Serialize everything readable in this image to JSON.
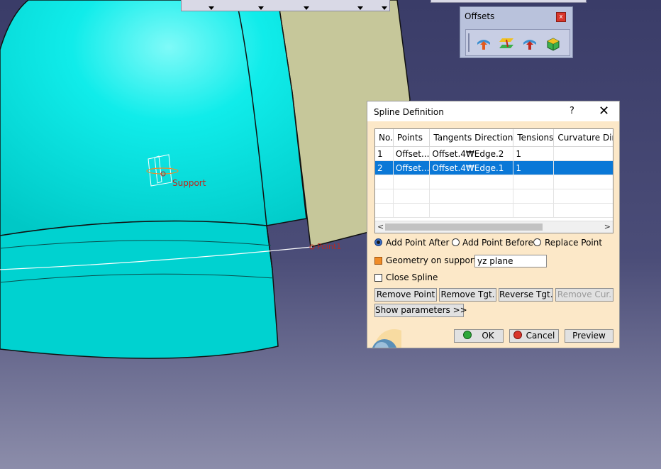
{
  "offsets_toolbar": {
    "title": "Offsets",
    "close": "x"
  },
  "dialog": {
    "title": "Spline Definition",
    "help": "?",
    "close": "✕",
    "table": {
      "headers": [
        "No.",
        "Points",
        "Tangents Direction",
        "Tensions",
        "Curvature Direc"
      ],
      "rows": [
        [
          "1",
          "Offset...",
          "Offset.4₩Edge.2",
          "1",
          ""
        ],
        [
          "2",
          "Offset...",
          "Offset.4₩Edge.1",
          "1",
          ""
        ]
      ],
      "selected_row": 2
    },
    "options": {
      "add_point_after": "Add Point After",
      "add_point_before": "Add Point Before",
      "replace_point": "Replace Point",
      "selected": "Add Point After"
    },
    "geometry_on_support": {
      "label": "Geometry on support",
      "value": "yz plane",
      "checked": true
    },
    "close_spline": {
      "label": "Close Spline",
      "checked": false
    },
    "buttons": {
      "remove_point": "Remove Point",
      "remove_tgt": "Remove Tgt.",
      "reverse_tgt": "Reverse Tgt.",
      "remove_cur": "Remove Cur.",
      "show_parameters": "Show parameters >>",
      "ok": "OK",
      "cancel": "Cancel",
      "preview": "Preview"
    }
  },
  "viewport_labels": {
    "support": "Support",
    "point": "Point1"
  },
  "colors": {
    "background_top": "#3d3f6b",
    "background_bottom": "#8a8ba8",
    "surface_cyan": "#00dcd8",
    "surface_khaki": "#c6c79a",
    "selection": "#0a78d7",
    "dialog_bg": "#fce8c8",
    "label_red": "#c0261c"
  }
}
